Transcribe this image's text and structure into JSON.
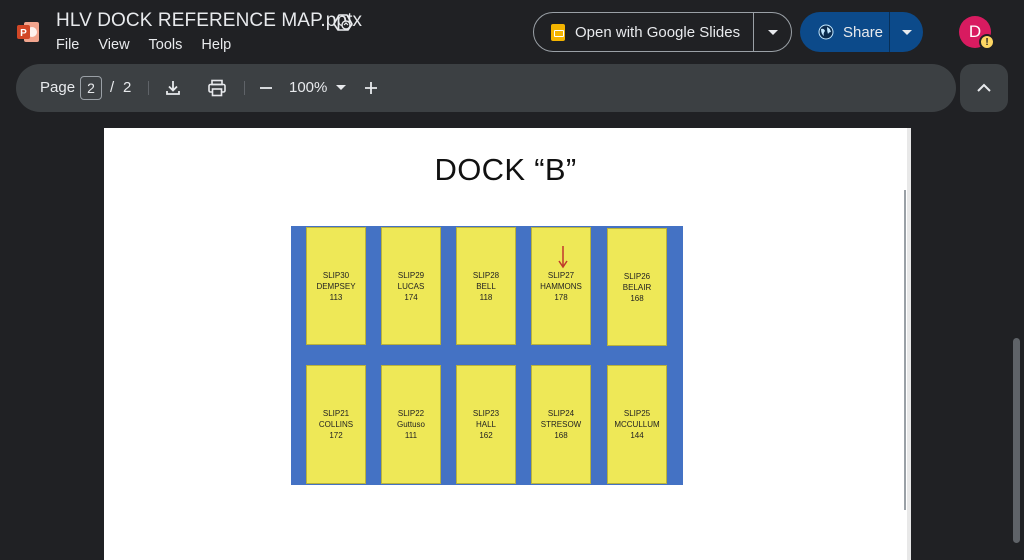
{
  "header": {
    "title": "HLV DOCK REFERENCE MAP.pptx",
    "app_icon": "powerpoint-icon",
    "app_icon_letter": "P",
    "badge_icon": "drive-sync-icon",
    "menu": [
      "File",
      "View",
      "Tools",
      "Help"
    ],
    "open_with_label": "Open with Google Slides",
    "share_label": "Share",
    "avatar_letter": "D",
    "avatar_warning": "!"
  },
  "toolbar": {
    "page_label": "Page",
    "current_page": "2",
    "page_sep": "/",
    "total_pages": "2",
    "zoom": "100%",
    "icons": [
      "download-icon",
      "print-icon",
      "zoom-out-icon",
      "zoom-dropdown-icon",
      "zoom-in-icon",
      "collapse-icon"
    ]
  },
  "slide": {
    "title": "DOCK “B”",
    "top_row": [
      {
        "slip": "SLIP30",
        "name": "DEMPSEY",
        "number": "113"
      },
      {
        "slip": "SLIP29",
        "name": "LUCAS",
        "number": "174"
      },
      {
        "slip": "SLIP28",
        "name": "BELL",
        "number": "118"
      },
      {
        "slip": "SLIP27",
        "name": "HAMMONS",
        "number": "178",
        "marker": "down-arrow"
      },
      {
        "slip": "SLIP26",
        "name": "BELAIR",
        "number": "168"
      }
    ],
    "bottom_row": [
      {
        "slip": "SLIP21",
        "name": "COLLINS",
        "number": "172"
      },
      {
        "slip": "SLIP22",
        "name": "Guttuso",
        "number": "111"
      },
      {
        "slip": "SLIP23",
        "name": "HALL",
        "number": "162"
      },
      {
        "slip": "SLIP24",
        "name": "STRESOW",
        "number": "168"
      },
      {
        "slip": "SLIP25",
        "name": "MCCULLUM",
        "number": "144"
      }
    ],
    "colors": {
      "water": "#4472c4",
      "slip": "#eee857",
      "marker": "#c0392b"
    }
  }
}
